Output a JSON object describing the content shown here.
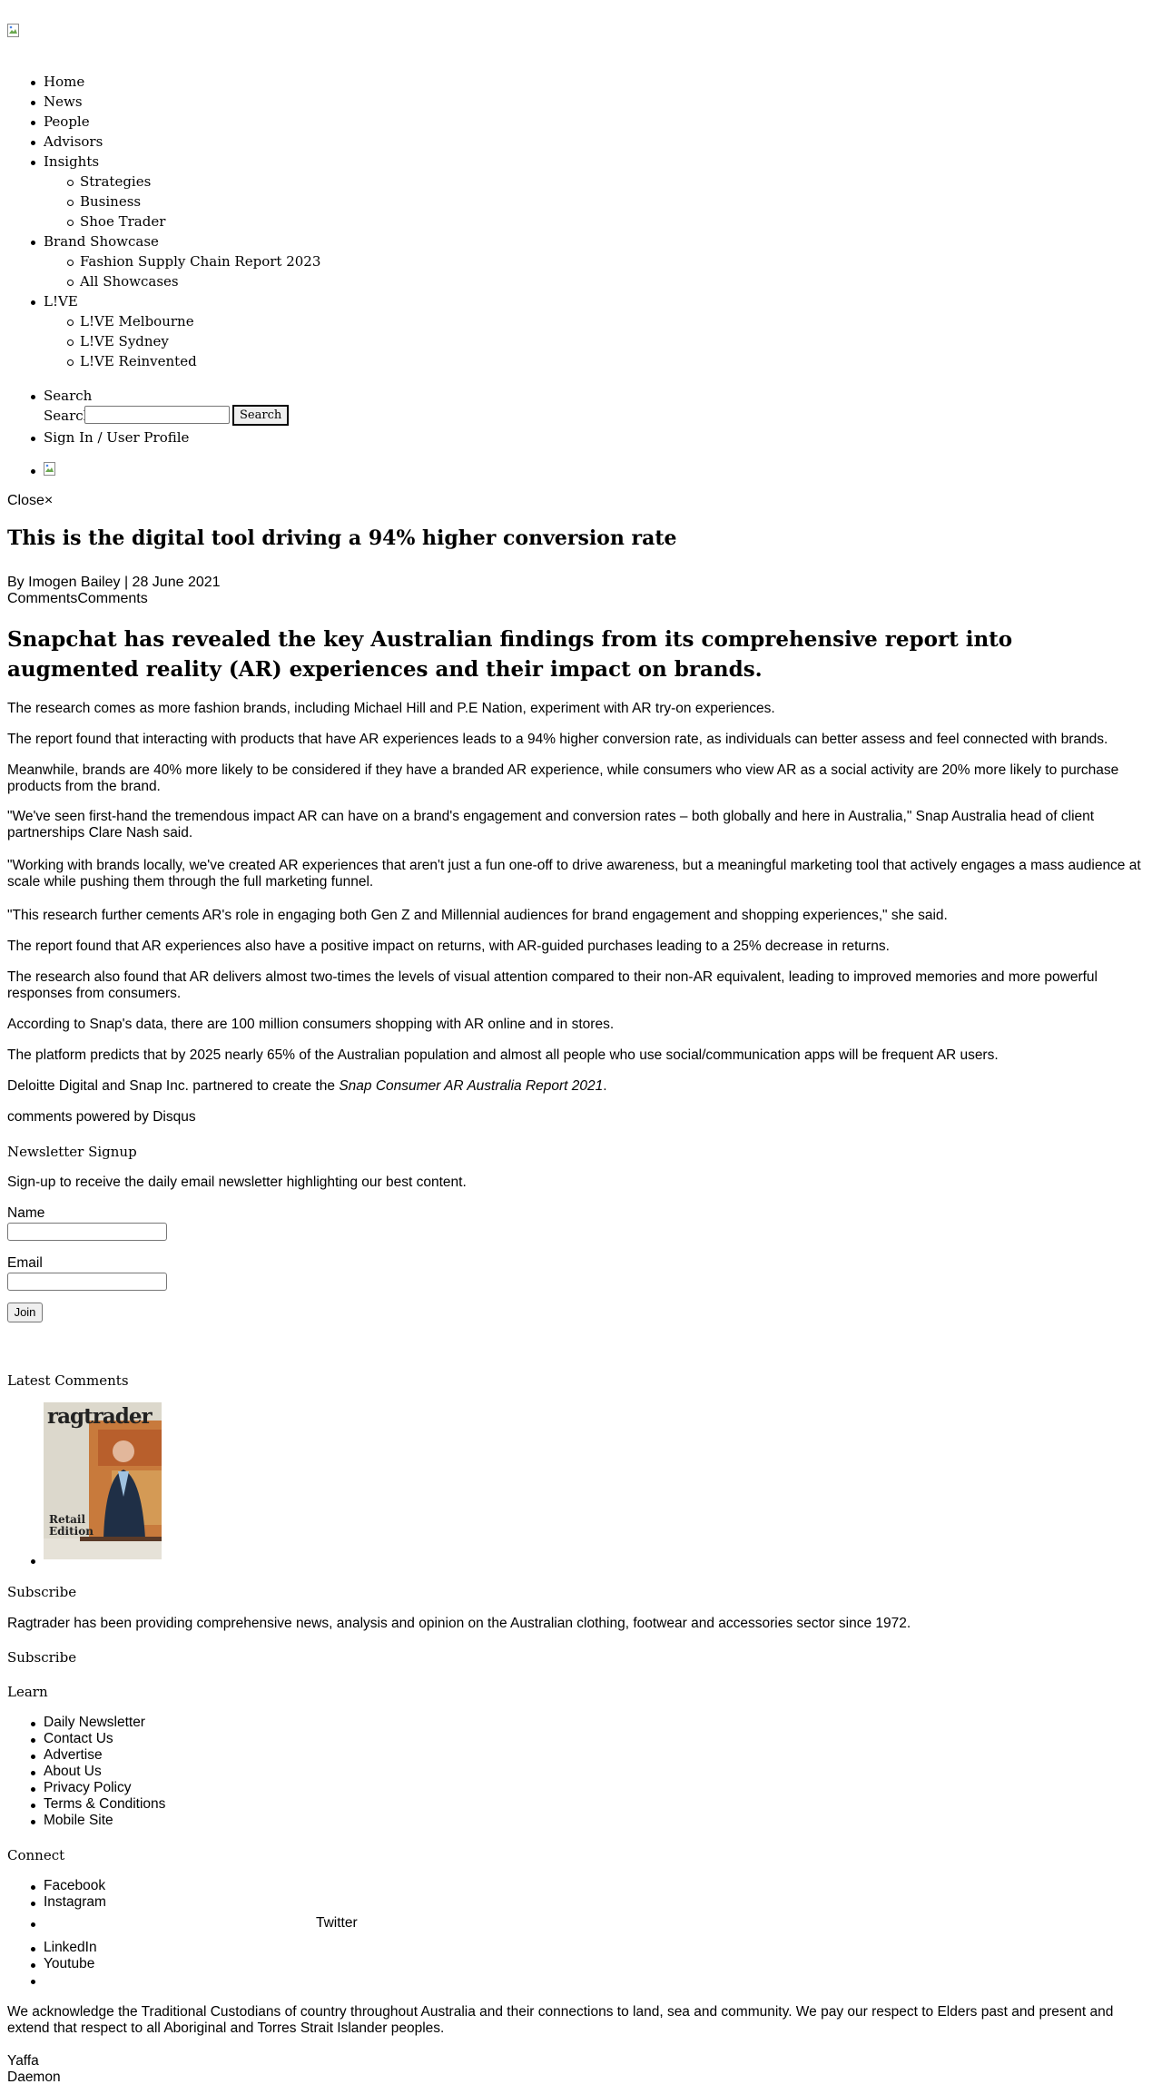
{
  "header": {
    "logo_icon": "broken-image-icon",
    "nav": [
      {
        "label": "Home"
      },
      {
        "label": "News"
      },
      {
        "label": "People"
      },
      {
        "label": "Advisors"
      },
      {
        "label": "Insights",
        "children": [
          "Strategies",
          "Business",
          "Shoe Trader"
        ]
      },
      {
        "label": "Brand Showcase",
        "children": [
          "Fashion Supply Chain Report 2023",
          "All Showcases"
        ]
      },
      {
        "label": "L!VE",
        "children": [
          "L!VE Melbourne",
          "L!VE Sydney",
          "L!VE Reinvented"
        ]
      }
    ],
    "search": {
      "item_label": "Search",
      "field_label": "Search",
      "input_value": "",
      "button_label": "Search"
    },
    "sign_in": "Sign In / User Profile",
    "extra_icon": "broken-image-icon",
    "close": "Close×"
  },
  "article": {
    "title": "This is the digital tool driving a 94% higher conversion rate",
    "byline": "By Imogen Bailey | 28 June 2021",
    "comments_link": "CommentsComments",
    "lede": "Snapchat has revealed the key Australian findings from its comprehensive report into augmented reality (AR) experiences and their impact on brands.",
    "paragraphs": [
      "The research comes as more fashion brands, including Michael Hill and P.E Nation, experiment with AR try-on experiences.",
      "The report found that interacting with products that have AR experiences leads to a 94% higher conversion rate, as individuals can better assess and feel connected with brands.",
      "Meanwhile, brands are 40% more likely to be considered if they have a branded AR experience, while consumers who view AR as a social activity are 20% more likely to purchase products from the brand.",
      "\"We've seen first-hand the tremendous impact AR can have on a brand's engagement and conversion rates – both globally and here in Australia,\" Snap Australia head of client partnerships Clare Nash said.",
      "\"Working with brands locally, we've created AR experiences that aren't just a fun one-off to drive awareness, but a meaningful marketing tool that actively engages a mass audience at scale while pushing them through the full marketing funnel.",
      "\"This research further cements AR's role in engaging both Gen Z and Millennial audiences for brand engagement and shopping experiences,\" she said.",
      "The report found that AR experiences also have a positive impact on returns, with AR-guided purchases leading to a 25% decrease in returns.",
      "The research also found that AR delivers almost two-times the levels of visual attention compared to their non-AR equivalent, leading to improved memories and more powerful responses from consumers.",
      "According to Snap's data, there are 100 million consumers shopping with AR online and in stores.",
      "The platform predicts that by 2025 nearly 65% of the Australian population and almost all people who use social/communication apps will be frequent AR users."
    ],
    "final_prefix": "Deloitte Digital and Snap Inc. partnered to create the ",
    "final_italic": "Snap Consumer AR Australia Report 2021",
    "final_suffix": ".",
    "disqus": "comments powered by Disqus"
  },
  "newsletter": {
    "heading": "Newsletter Signup",
    "text": "Sign-up to receive the daily email newsletter highlighting our best content.",
    "name_label": "Name",
    "name_value": "",
    "email_label": "Email",
    "email_value": "",
    "join_label": "Join"
  },
  "latest_comments": {
    "heading": "Latest Comments",
    "cover": {
      "masthead": "ragtrader",
      "edition_line1": "Retail",
      "edition_line2": "Edition"
    }
  },
  "subscribe": {
    "heading": "Subscribe",
    "text": "Ragtrader has been providing comprehensive news, analysis and opinion on the Australian clothing, footwear and accessories sector since 1972.",
    "link": "Subscribe"
  },
  "learn": {
    "heading": "Learn",
    "items": [
      "Daily Newsletter",
      "Contact Us",
      "Advertise",
      "About Us",
      "Privacy Policy",
      "Terms & Conditions",
      "Mobile Site"
    ]
  },
  "connect": {
    "heading": "Connect",
    "items": [
      "Facebook",
      "Instagram",
      "Twitter",
      "LinkedIn",
      "Youtube",
      ""
    ]
  },
  "acknowledgement": "We acknowledge the Traditional Custodians of country throughout Australia and their connections to land, sea and community. We pay our respect to Elders past and present and extend that respect to all Aboriginal and Torres Strait Islander peoples.",
  "footer_brands": [
    "Yaffa",
    "Daemon"
  ]
}
